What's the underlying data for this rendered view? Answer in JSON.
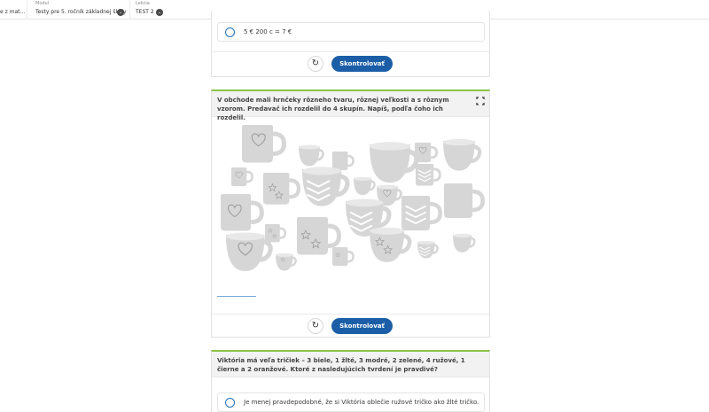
{
  "breadcrumb": {
    "items": [
      {
        "caption": "",
        "value": "e z mat..."
      },
      {
        "caption": "Modul",
        "value": "Testy pre 5. ročník základnej školy"
      },
      {
        "caption": "Lekcia",
        "value": "TEST 2"
      }
    ]
  },
  "card1": {
    "option_text": "5 € 200 c = 7 €",
    "reset_icon": "reset-icon",
    "check_label": "Skontrolovať"
  },
  "card2": {
    "question": "V obchode mali hrnčeky rôzneho tvaru, rôznej veľkosti a s rôznym vzorom. Predavač ich rozdelil do 4 skupín. Napíš, podľa čoho ich rozdelil.",
    "image_icon": "mugs-illustration",
    "check_label": "Skontrolovať"
  },
  "card3": {
    "question": "Viktória má veľa tričiek – 3 biele, 1 žlté, 3 modré, 2 zelené, 4 ružové, 1 čierne a 2 oranžové. Ktoré z nasledujúcich tvrdení je pravdivé?",
    "option_text": "Je menej pravdepodobné, že si Viktória oblečie ružové tričko ako žlté tričko."
  },
  "colors": {
    "accent": "#1b5ea7",
    "green": "#8bc34a",
    "mug": "#d6d6d6"
  }
}
